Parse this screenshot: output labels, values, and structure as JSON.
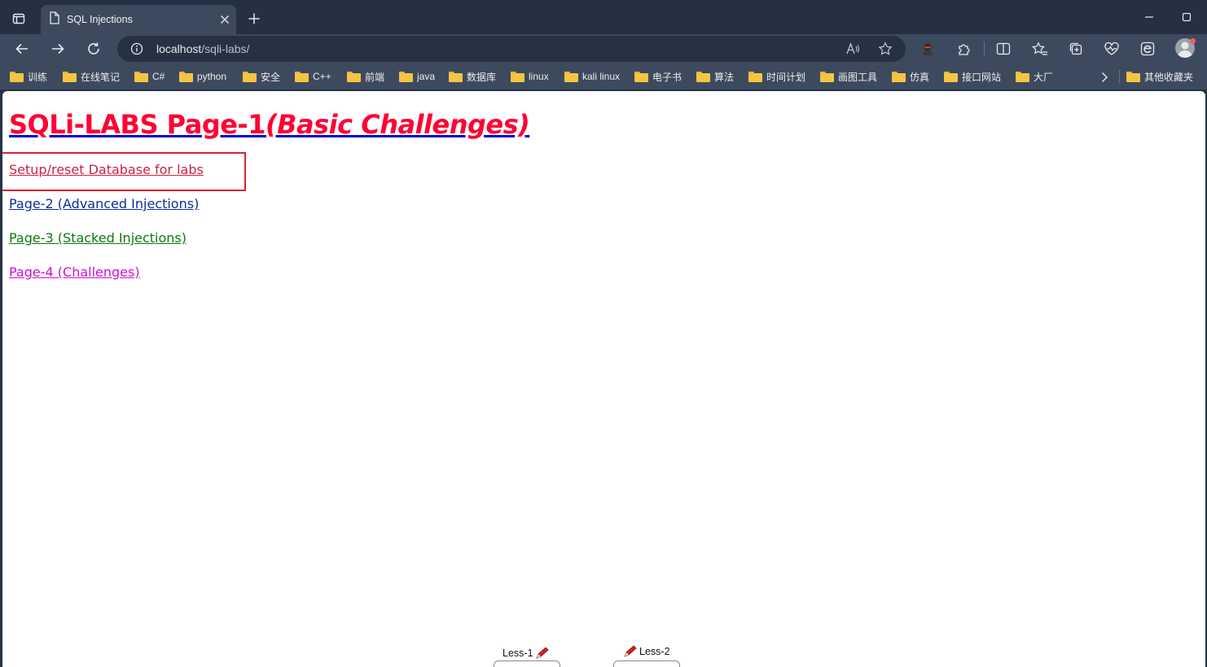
{
  "browser": {
    "tab": {
      "title": "SQL Injections"
    },
    "address": {
      "host": "localhost",
      "path": "/sqli-labs/"
    },
    "bookmarks": [
      {
        "label": "训练"
      },
      {
        "label": "在线笔记"
      },
      {
        "label": "C#"
      },
      {
        "label": "python"
      },
      {
        "label": "安全"
      },
      {
        "label": "C++"
      },
      {
        "label": "前端"
      },
      {
        "label": "java"
      },
      {
        "label": "数据库"
      },
      {
        "label": "linux"
      },
      {
        "label": "kali linux"
      },
      {
        "label": "电子书"
      },
      {
        "label": "算法"
      },
      {
        "label": "时间计划"
      },
      {
        "label": "画图工具"
      },
      {
        "label": "仿真"
      },
      {
        "label": "接口网站"
      },
      {
        "label": "大厂"
      }
    ],
    "other_bookmarks": {
      "label": "其他收藏夹"
    }
  },
  "page": {
    "title_main": "SQLi-LABS Page-1",
    "title_sub": "(Basic Challenges)",
    "links": [
      {
        "label": "Setup/reset Database for labs"
      },
      {
        "label": "Page-2 (Advanced Injections)"
      },
      {
        "label": "Page-3 (Stacked Injections)"
      },
      {
        "label": "Page-4 (Challenges)"
      }
    ],
    "lessons": [
      {
        "label": "Less-1"
      },
      {
        "label": "Less-2"
      }
    ]
  },
  "colors": {
    "title": "#ff0033",
    "title_underline": "#0000cc",
    "highlight_box": "#d8232a",
    "link_setup": "#cc2244",
    "link_page2": "#0b2e9a",
    "link_page3": "#0b7a0b",
    "link_page4": "#d010d0",
    "folder": "#f5c542"
  },
  "icons": {
    "tab_actions": "tab-actions-icon",
    "tab_favicon": "page-icon",
    "tab_close": "close-icon",
    "new_tab": "plus-icon",
    "minimize": "minimize-icon",
    "maximize": "maximize-icon",
    "back": "back-arrow-icon",
    "forward": "forward-arrow-icon",
    "refresh": "refresh-icon",
    "site_info": "info-icon",
    "read_aloud": "read-aloud-icon",
    "favorite": "star-icon",
    "extension": "puzzle-icon",
    "split_screen": "split-screen-icon",
    "favorites": "favorites-icon",
    "collections": "collections-icon",
    "performance": "heartbeat-icon",
    "ie_mode": "ie-mode-icon",
    "profile": "avatar"
  }
}
